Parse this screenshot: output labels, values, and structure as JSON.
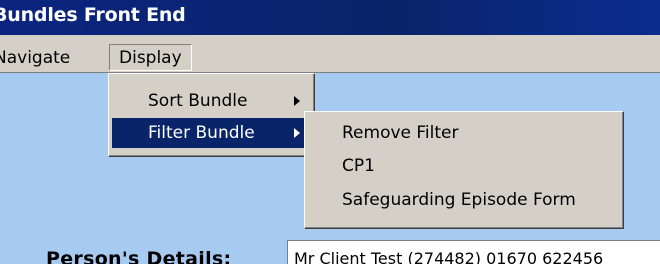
{
  "window": {
    "title": "Bundles Front End"
  },
  "menubar": {
    "items": [
      {
        "label": "Navigate"
      },
      {
        "label": "Display"
      }
    ]
  },
  "display_menu": {
    "items": [
      {
        "label": "Sort Bundle",
        "has_submenu": true
      },
      {
        "label": "Filter Bundle",
        "has_submenu": true,
        "highlighted": true
      }
    ]
  },
  "filter_submenu": {
    "items": [
      {
        "label": "Remove Filter"
      },
      {
        "label": "CP1"
      },
      {
        "label": "Safeguarding Episode Form"
      }
    ]
  },
  "person": {
    "label": "Person's Details:",
    "value": "Mr Client Test (274482) 01670 622456"
  },
  "colors": {
    "titlebar": "#0a246a",
    "menu_face": "#d4d0c8",
    "highlight": "#0a246a",
    "background": "#a6caf0"
  }
}
